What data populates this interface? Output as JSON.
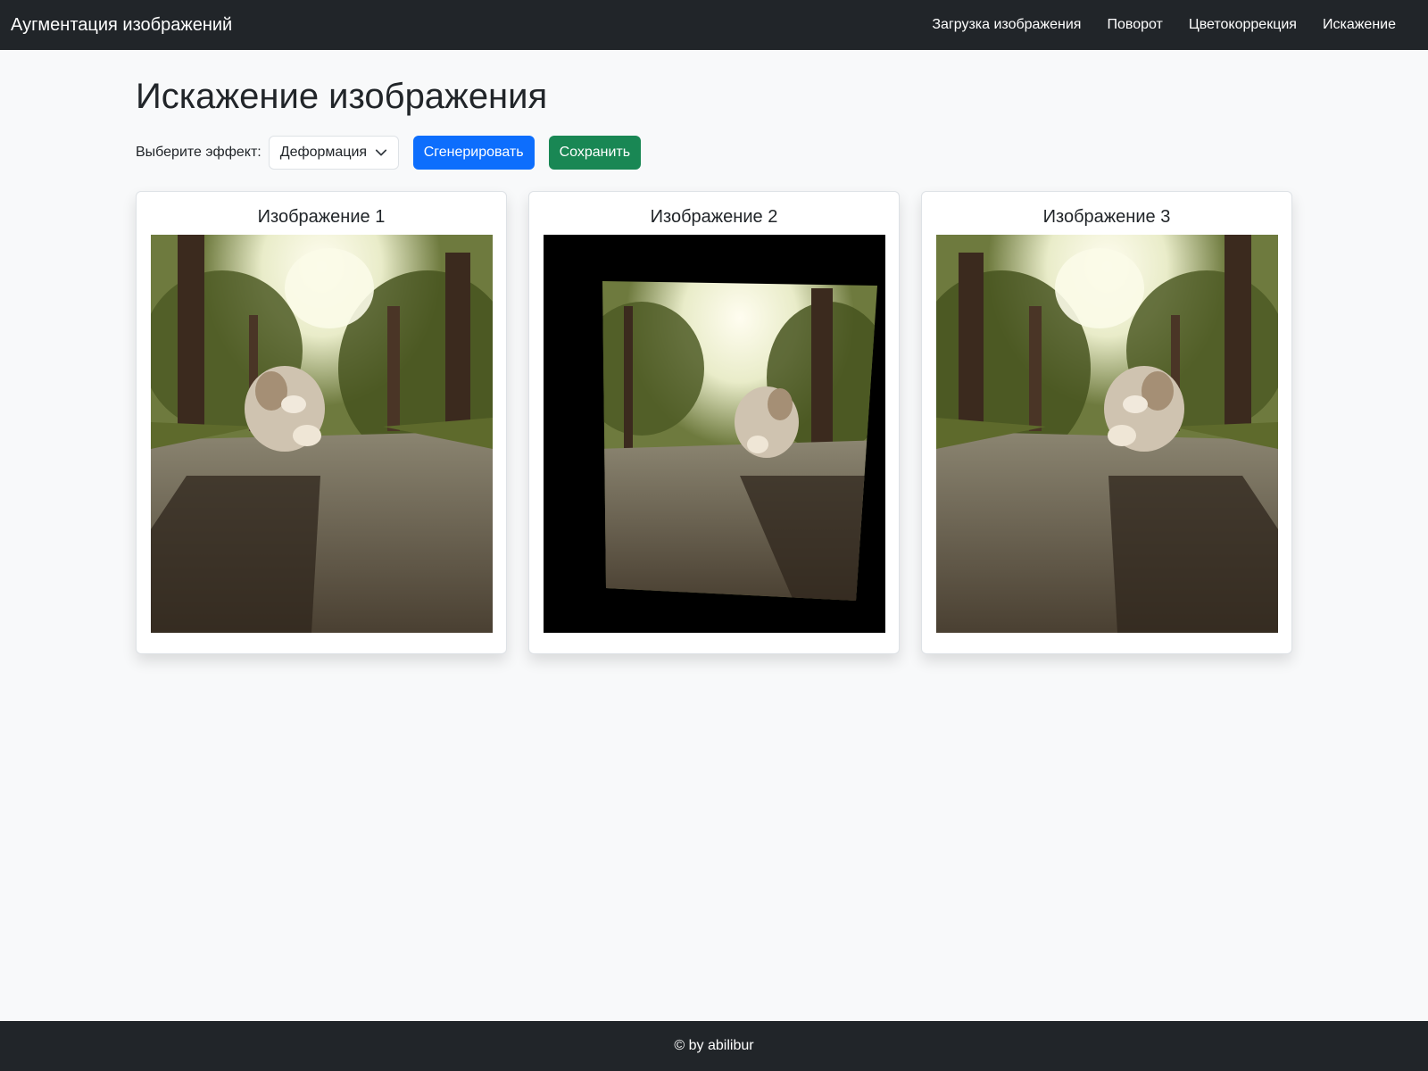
{
  "navbar": {
    "brand": "Аугментация изображений",
    "links": [
      "Загрузка изображения",
      "Поворот",
      "Цветокоррекция",
      "Искажение"
    ]
  },
  "page": {
    "title": "Искажение изображения",
    "effect_label": "Выберите эффект:",
    "effect_selected": "Деформация",
    "generate_label": "Сгенерировать",
    "save_label": "Сохранить"
  },
  "cards": [
    {
      "title": "Изображение 1"
    },
    {
      "title": "Изображение 2"
    },
    {
      "title": "Изображение 3"
    }
  ],
  "footer": {
    "text": "© by abilibur"
  },
  "colors": {
    "navbar": "#212529",
    "primary": "#0d6efd",
    "success": "#198754",
    "background": "#f8f9fa"
  },
  "icons": {
    "select": "chevron-down-icon"
  }
}
